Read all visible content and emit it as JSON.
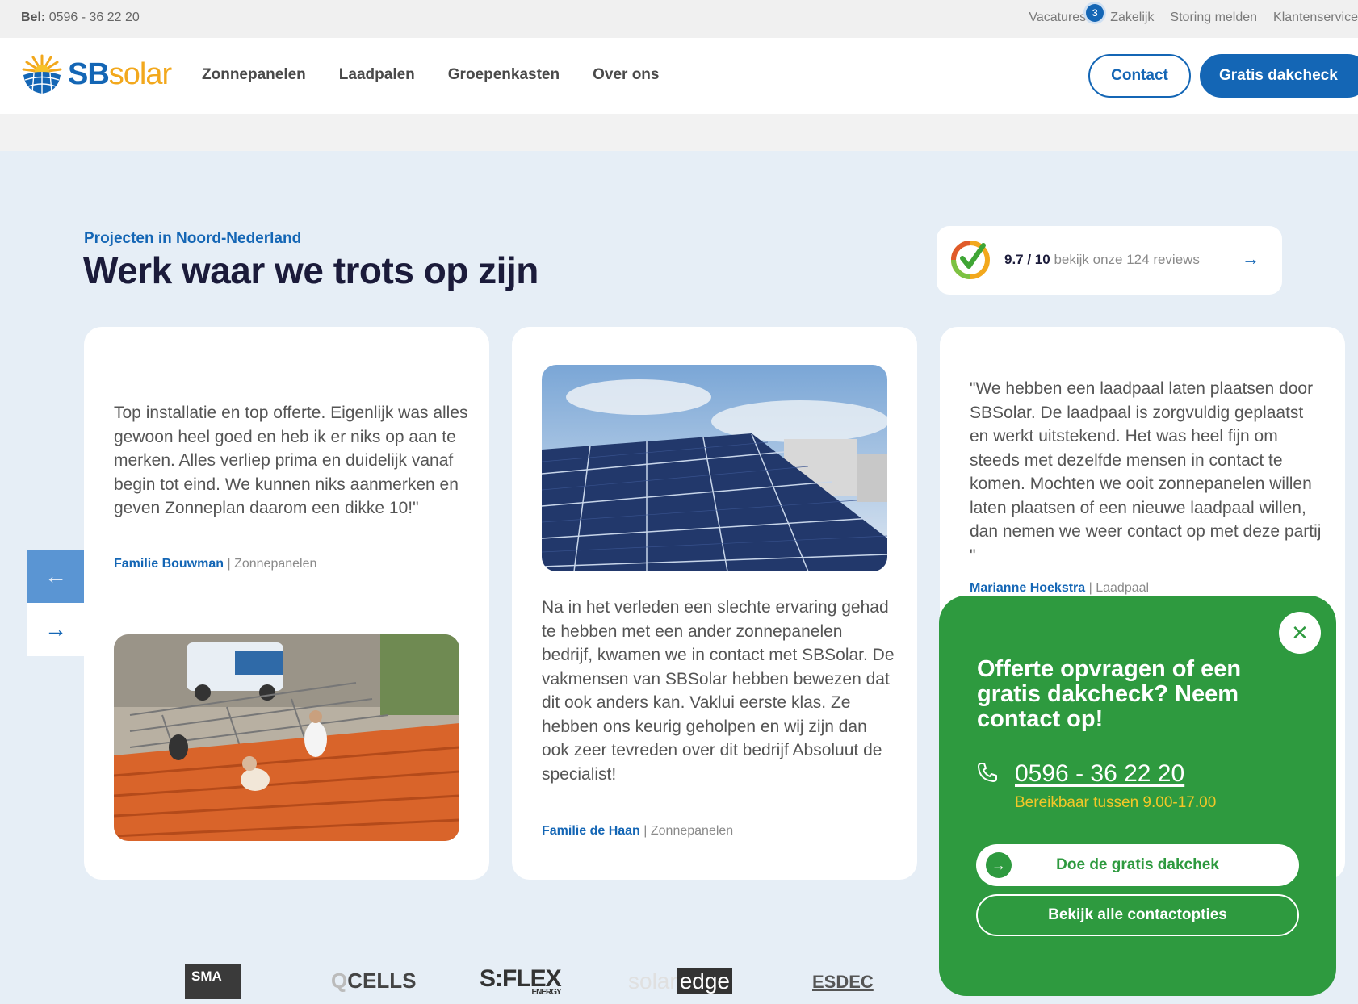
{
  "topbar": {
    "phone_label": "Bel:",
    "phone_number": "0596 - 36 22 20",
    "links": [
      "Vacatures",
      "Zakelijk",
      "Storing melden",
      "Klantenservice"
    ],
    "vacatures_count": "3"
  },
  "header": {
    "logo_sb": "SB",
    "logo_solar": "solar",
    "nav": [
      "Zonnepanelen",
      "Laadpalen",
      "Groepenkasten",
      "Over ons"
    ],
    "contact_label": "Contact",
    "dakcheck_label": "Gratis dakcheck"
  },
  "section": {
    "eyebrow": "Projecten in Noord-Nederland",
    "title": "Werk waar we trots op zijn"
  },
  "review": {
    "score": "9.7 / 10",
    "text": "bekijk onze 124 reviews"
  },
  "cards": [
    {
      "quote": "Top installatie en top offerte. Eigenlijk was alles gewoon heel goed en heb ik er niks op aan te merken. Alles verliep prima en duidelijk vanaf begin tot eind. We kunnen niks aanmerken en geven Zonneplan daarom een dikke 10!\"",
      "author": "Familie Bouwman",
      "category": "Zonnepanelen"
    },
    {
      "quote": "Na in het verleden een slechte ervaring gehad te hebben met een ander zonnepanelen bedrijf, kwamen we in contact met SBSolar. De vakmensen van SBSolar hebben bewezen dat dit ook anders kan. Vaklui eerste klas. Ze hebben ons keurig geholpen en wij zijn dan ook zeer tevreden over dit bedrijf Absoluut de specialist!",
      "author": "Familie de Haan",
      "category": "Zonnepanelen"
    },
    {
      "quote": "\"We hebben een laadpaal laten plaatsen door SBSolar. De laadpaal is zorgvuldig geplaatst en werkt uitstekend. Het was heel fijn om steeds met dezelfde mensen in contact te komen. Mochten we ooit zonnepanelen willen laten plaatsen of een nieuwe laadpaal willen, dan nemen we weer contact op met deze partij \"",
      "author": "Marianne Hoekstra",
      "category": "Laadpaal"
    }
  ],
  "popup": {
    "title": "Offerte opvragen of een gratis dakcheck? Neem contact op!",
    "phone": "0596 - 36 22 20",
    "hours": "Bereikbaar tussen 9.00-17.00",
    "primary_button": "Doe de gratis dakchek",
    "secondary_button": "Bekijk alle contactopties",
    "close_icon": "close-icon"
  },
  "partners": {
    "sma": "SMA",
    "qcells": "CELLS",
    "sflex": "S:FLEX",
    "sflex_sub": "ENERGY",
    "solaredge_a": "solar",
    "solaredge_b": "edge",
    "esdec": "ESDEC"
  },
  "colors": {
    "brand_blue": "#1466b5",
    "brand_orange": "#f2a81d",
    "popup_green": "#2e9a3f",
    "hours_yellow": "#f3c728",
    "background": "#e6eef6"
  }
}
